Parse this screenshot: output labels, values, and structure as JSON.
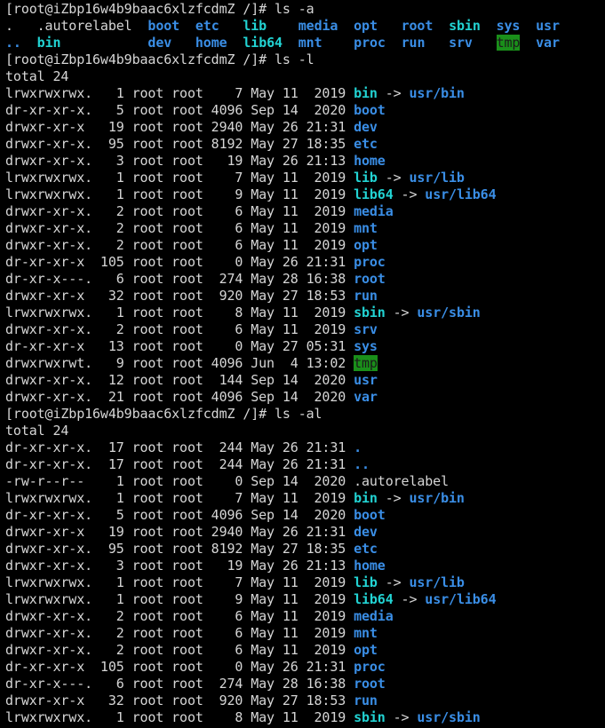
{
  "window": {
    "title": "terminal"
  },
  "colors": {
    "background": "#000000",
    "text": "#d6d6d6",
    "directory": "#3a8ee6",
    "symlink": "#22d3d3",
    "sticky_dir_fg": "#1b1b1b",
    "sticky_dir_bg": "#1a8f1a"
  },
  "lines": [
    [
      {
        "t": "[root@iZbp16w4b9baac6xlzfcdmZ /]# ls -a",
        "c": ""
      }
    ],
    [
      {
        "t": ".   .autorelabel  ",
        "c": ""
      },
      {
        "t": "boot",
        "c": "dir"
      },
      {
        "t": "  ",
        "c": ""
      },
      {
        "t": "etc",
        "c": "dir"
      },
      {
        "t": "   ",
        "c": ""
      },
      {
        "t": "lib",
        "c": "lnk"
      },
      {
        "t": "    ",
        "c": ""
      },
      {
        "t": "media",
        "c": "dir"
      },
      {
        "t": "  ",
        "c": ""
      },
      {
        "t": "opt",
        "c": "dir"
      },
      {
        "t": "   ",
        "c": ""
      },
      {
        "t": "root",
        "c": "dir"
      },
      {
        "t": "  ",
        "c": ""
      },
      {
        "t": "sbin",
        "c": "lnk"
      },
      {
        "t": "  ",
        "c": ""
      },
      {
        "t": "sys",
        "c": "dir"
      },
      {
        "t": "  ",
        "c": ""
      },
      {
        "t": "usr",
        "c": "dir"
      }
    ],
    [
      {
        "t": "..",
        "c": "dir"
      },
      {
        "t": "  ",
        "c": ""
      },
      {
        "t": "bin",
        "c": "lnk"
      },
      {
        "t": "           ",
        "c": ""
      },
      {
        "t": "dev",
        "c": "dir"
      },
      {
        "t": "   ",
        "c": ""
      },
      {
        "t": "home",
        "c": "dir"
      },
      {
        "t": "  ",
        "c": ""
      },
      {
        "t": "lib64",
        "c": "lnk"
      },
      {
        "t": "  ",
        "c": ""
      },
      {
        "t": "mnt",
        "c": "dir"
      },
      {
        "t": "    ",
        "c": ""
      },
      {
        "t": "proc",
        "c": "dir"
      },
      {
        "t": "  ",
        "c": ""
      },
      {
        "t": "run",
        "c": "dir"
      },
      {
        "t": "   ",
        "c": ""
      },
      {
        "t": "srv",
        "c": "dir"
      },
      {
        "t": "   ",
        "c": ""
      },
      {
        "t": "tmp",
        "c": "tmp"
      },
      {
        "t": "  ",
        "c": ""
      },
      {
        "t": "var",
        "c": "dir"
      }
    ],
    [
      {
        "t": "[root@iZbp16w4b9baac6xlzfcdmZ /]# ls -l",
        "c": ""
      }
    ],
    [
      {
        "t": "total 24",
        "c": ""
      }
    ],
    [
      {
        "t": "lrwxrwxrwx.   1 root root    7 May 11  2019 ",
        "c": ""
      },
      {
        "t": "bin",
        "c": "lnk"
      },
      {
        "t": " -> ",
        "c": ""
      },
      {
        "t": "usr/bin",
        "c": "dir"
      }
    ],
    [
      {
        "t": "dr-xr-xr-x.   5 root root 4096 Sep 14  2020 ",
        "c": ""
      },
      {
        "t": "boot",
        "c": "dir"
      }
    ],
    [
      {
        "t": "drwxr-xr-x   19 root root 2940 May 26 21:31 ",
        "c": ""
      },
      {
        "t": "dev",
        "c": "dir"
      }
    ],
    [
      {
        "t": "drwxr-xr-x.  95 root root 8192 May 27 18:35 ",
        "c": ""
      },
      {
        "t": "etc",
        "c": "dir"
      }
    ],
    [
      {
        "t": "drwxr-xr-x.   3 root root   19 May 26 21:13 ",
        "c": ""
      },
      {
        "t": "home",
        "c": "dir"
      }
    ],
    [
      {
        "t": "lrwxrwxrwx.   1 root root    7 May 11  2019 ",
        "c": ""
      },
      {
        "t": "lib",
        "c": "lnk"
      },
      {
        "t": " -> ",
        "c": ""
      },
      {
        "t": "usr/lib",
        "c": "dir"
      }
    ],
    [
      {
        "t": "lrwxrwxrwx.   1 root root    9 May 11  2019 ",
        "c": ""
      },
      {
        "t": "lib64",
        "c": "lnk"
      },
      {
        "t": " -> ",
        "c": ""
      },
      {
        "t": "usr/lib64",
        "c": "dir"
      }
    ],
    [
      {
        "t": "drwxr-xr-x.   2 root root    6 May 11  2019 ",
        "c": ""
      },
      {
        "t": "media",
        "c": "dir"
      }
    ],
    [
      {
        "t": "drwxr-xr-x.   2 root root    6 May 11  2019 ",
        "c": ""
      },
      {
        "t": "mnt",
        "c": "dir"
      }
    ],
    [
      {
        "t": "drwxr-xr-x.   2 root root    6 May 11  2019 ",
        "c": ""
      },
      {
        "t": "opt",
        "c": "dir"
      }
    ],
    [
      {
        "t": "dr-xr-xr-x  105 root root    0 May 26 21:31 ",
        "c": ""
      },
      {
        "t": "proc",
        "c": "dir"
      }
    ],
    [
      {
        "t": "dr-xr-x---.   6 root root  274 May 28 16:38 ",
        "c": ""
      },
      {
        "t": "root",
        "c": "dir"
      }
    ],
    [
      {
        "t": "drwxr-xr-x   32 root root  920 May 27 18:53 ",
        "c": ""
      },
      {
        "t": "run",
        "c": "dir"
      }
    ],
    [
      {
        "t": "lrwxrwxrwx.   1 root root    8 May 11  2019 ",
        "c": ""
      },
      {
        "t": "sbin",
        "c": "lnk"
      },
      {
        "t": " -> ",
        "c": ""
      },
      {
        "t": "usr/sbin",
        "c": "dir"
      }
    ],
    [
      {
        "t": "drwxr-xr-x.   2 root root    6 May 11  2019 ",
        "c": ""
      },
      {
        "t": "srv",
        "c": "dir"
      }
    ],
    [
      {
        "t": "dr-xr-xr-x   13 root root    0 May 27 05:31 ",
        "c": ""
      },
      {
        "t": "sys",
        "c": "dir"
      }
    ],
    [
      {
        "t": "drwxrwxrwt.   9 root root 4096 Jun  4 13:02 ",
        "c": ""
      },
      {
        "t": "tmp",
        "c": "tmp"
      }
    ],
    [
      {
        "t": "drwxr-xr-x.  12 root root  144 Sep 14  2020 ",
        "c": ""
      },
      {
        "t": "usr",
        "c": "dir"
      }
    ],
    [
      {
        "t": "drwxr-xr-x.  21 root root 4096 Sep 14  2020 ",
        "c": ""
      },
      {
        "t": "var",
        "c": "dir"
      }
    ],
    [
      {
        "t": "[root@iZbp16w4b9baac6xlzfcdmZ /]# ls -al",
        "c": ""
      }
    ],
    [
      {
        "t": "total 24",
        "c": ""
      }
    ],
    [
      {
        "t": "dr-xr-xr-x.  17 root root  244 May 26 21:31 ",
        "c": ""
      },
      {
        "t": ".",
        "c": "dir"
      }
    ],
    [
      {
        "t": "dr-xr-xr-x.  17 root root  244 May 26 21:31 ",
        "c": ""
      },
      {
        "t": "..",
        "c": "dir"
      }
    ],
    [
      {
        "t": "-rw-r--r--    1 root root    0 Sep 14  2020 .autorelabel",
        "c": ""
      }
    ],
    [
      {
        "t": "lrwxrwxrwx.   1 root root    7 May 11  2019 ",
        "c": ""
      },
      {
        "t": "bin",
        "c": "lnk"
      },
      {
        "t": " -> ",
        "c": ""
      },
      {
        "t": "usr/bin",
        "c": "dir"
      }
    ],
    [
      {
        "t": "dr-xr-xr-x.   5 root root 4096 Sep 14  2020 ",
        "c": ""
      },
      {
        "t": "boot",
        "c": "dir"
      }
    ],
    [
      {
        "t": "drwxr-xr-x   19 root root 2940 May 26 21:31 ",
        "c": ""
      },
      {
        "t": "dev",
        "c": "dir"
      }
    ],
    [
      {
        "t": "drwxr-xr-x.  95 root root 8192 May 27 18:35 ",
        "c": ""
      },
      {
        "t": "etc",
        "c": "dir"
      }
    ],
    [
      {
        "t": "drwxr-xr-x.   3 root root   19 May 26 21:13 ",
        "c": ""
      },
      {
        "t": "home",
        "c": "dir"
      }
    ],
    [
      {
        "t": "lrwxrwxrwx.   1 root root    7 May 11  2019 ",
        "c": ""
      },
      {
        "t": "lib",
        "c": "lnk"
      },
      {
        "t": " -> ",
        "c": ""
      },
      {
        "t": "usr/lib",
        "c": "dir"
      }
    ],
    [
      {
        "t": "lrwxrwxrwx.   1 root root    9 May 11  2019 ",
        "c": ""
      },
      {
        "t": "lib64",
        "c": "lnk"
      },
      {
        "t": " -> ",
        "c": ""
      },
      {
        "t": "usr/lib64",
        "c": "dir"
      }
    ],
    [
      {
        "t": "drwxr-xr-x.   2 root root    6 May 11  2019 ",
        "c": ""
      },
      {
        "t": "media",
        "c": "dir"
      }
    ],
    [
      {
        "t": "drwxr-xr-x.   2 root root    6 May 11  2019 ",
        "c": ""
      },
      {
        "t": "mnt",
        "c": "dir"
      }
    ],
    [
      {
        "t": "drwxr-xr-x.   2 root root    6 May 11  2019 ",
        "c": ""
      },
      {
        "t": "opt",
        "c": "dir"
      }
    ],
    [
      {
        "t": "dr-xr-xr-x  105 root root    0 May 26 21:31 ",
        "c": ""
      },
      {
        "t": "proc",
        "c": "dir"
      }
    ],
    [
      {
        "t": "dr-xr-x---.   6 root root  274 May 28 16:38 ",
        "c": ""
      },
      {
        "t": "root",
        "c": "dir"
      }
    ],
    [
      {
        "t": "drwxr-xr-x   32 root root  920 May 27 18:53 ",
        "c": ""
      },
      {
        "t": "run",
        "c": "dir"
      }
    ],
    [
      {
        "t": "lrwxrwxrwx.   1 root root    8 May 11  2019 ",
        "c": ""
      },
      {
        "t": "sbin",
        "c": "lnk"
      },
      {
        "t": " -> ",
        "c": ""
      },
      {
        "t": "usr/sbin",
        "c": "dir"
      }
    ]
  ]
}
